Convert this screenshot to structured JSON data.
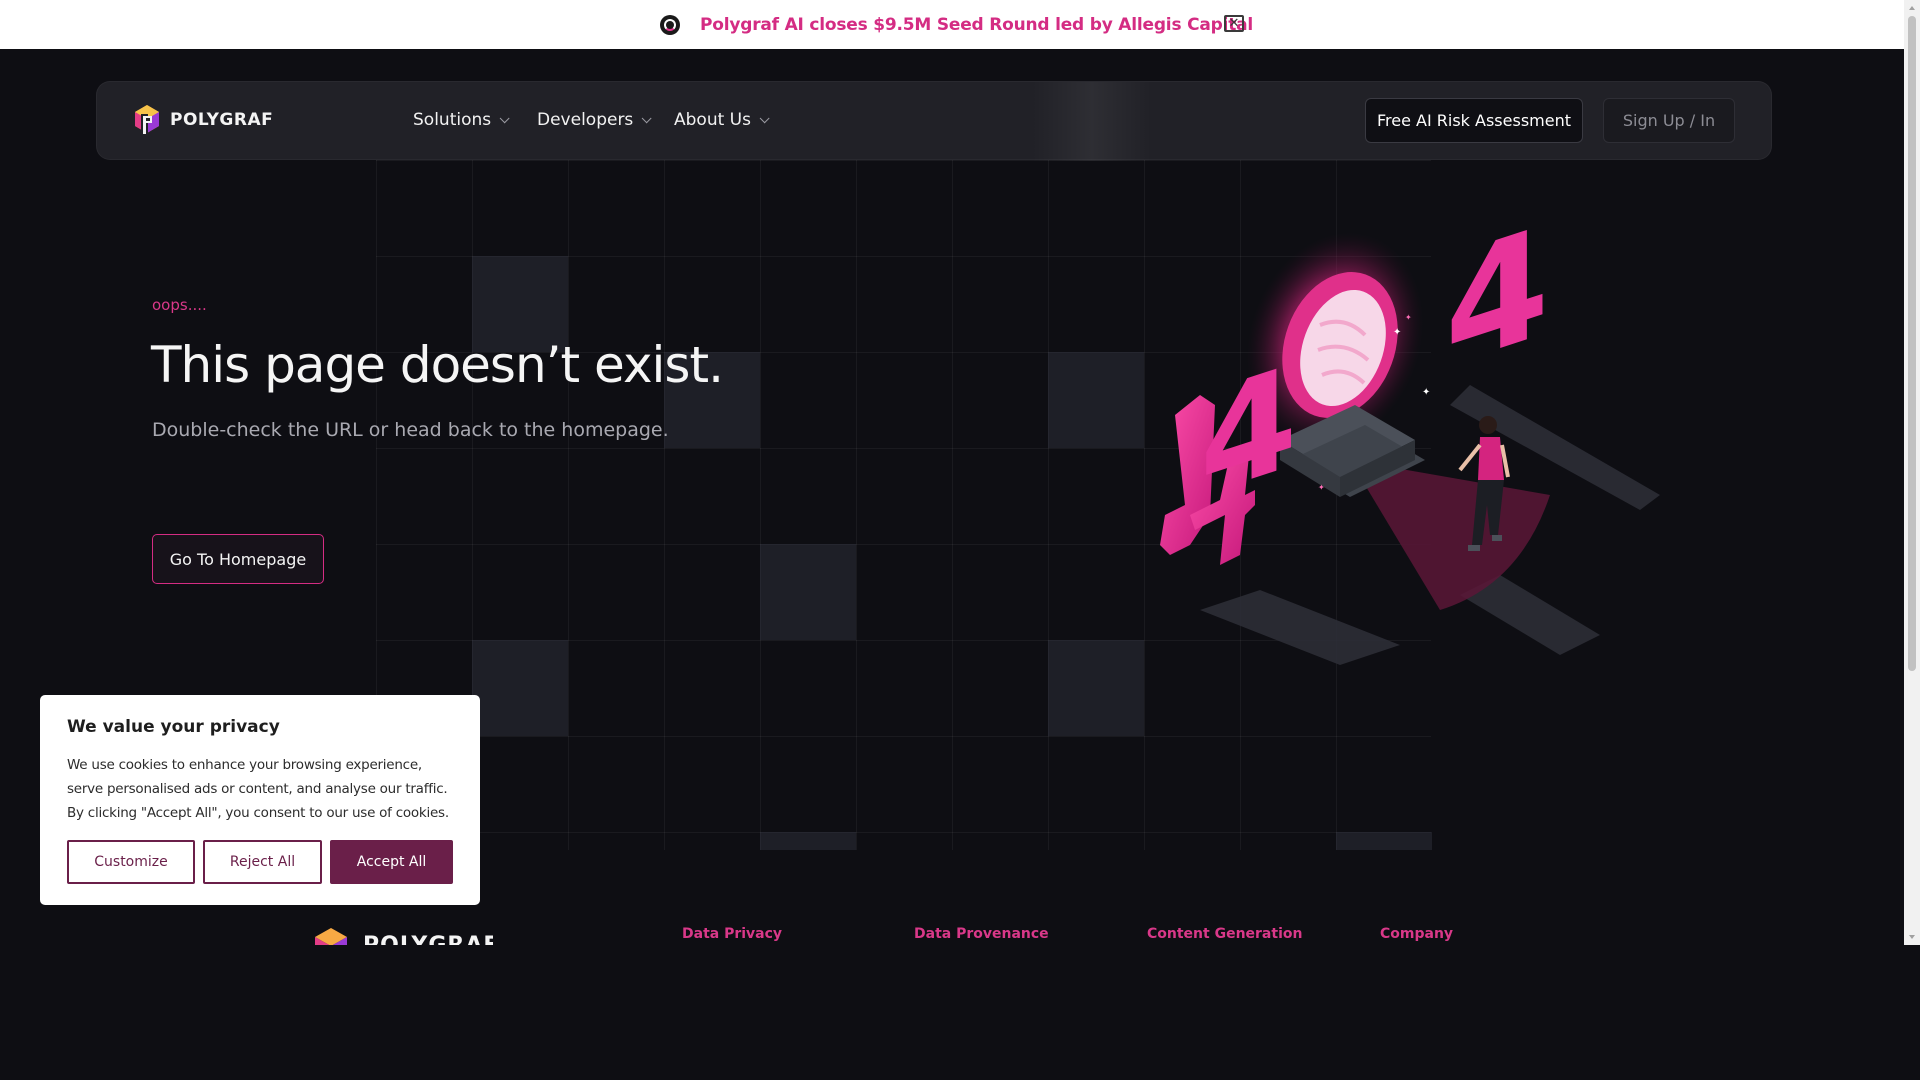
{
  "announcement": {
    "text": "Polygraf AI closes $9.5M Seed Round led by Allegis Capital",
    "close_glyph": "✕"
  },
  "nav": {
    "logo_text": "POLYGRAF",
    "items": [
      {
        "label": "Solutions"
      },
      {
        "label": "Developers"
      },
      {
        "label": "About Us"
      }
    ],
    "cta_primary": "Free AI Risk Assessment",
    "cta_secondary": "Sign Up / In"
  },
  "hero": {
    "eyebrow": "oops....",
    "title": "This page doesn’t exist.",
    "subtitle": "Double-check the URL or head back to the homepage.",
    "button": "Go To Homepage"
  },
  "illustration": {
    "digits": [
      "4",
      "0",
      "4"
    ]
  },
  "cookie": {
    "title": "We value your privacy",
    "body": "We use cookies to enhance your browsing experience, serve personalised ads or content, and analyse our traffic. By clicking \"Accept All\", you consent to our use of cookies.",
    "customize": "Customize",
    "reject": "Reject All",
    "accept": "Accept All"
  },
  "footer": {
    "logo_text": "POLYGRAF",
    "columns": [
      {
        "label": "Data Privacy"
      },
      {
        "label": "Data Provenance"
      },
      {
        "label": "Content Generation"
      },
      {
        "label": "Company"
      }
    ]
  },
  "colors": {
    "accent": "#d42c83",
    "cookie_accent": "#6a1f49",
    "background": "#0e0e13",
    "navbar": "#212127"
  }
}
